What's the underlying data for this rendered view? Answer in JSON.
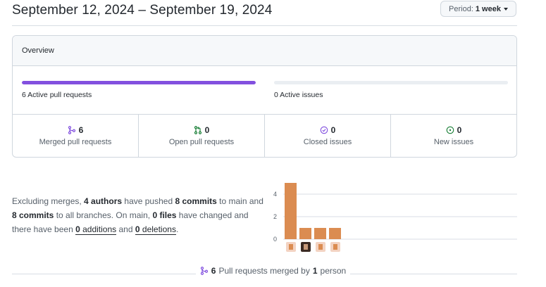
{
  "header": {
    "title": "September 12, 2024 – September 19, 2024",
    "period_prefix": "Period:",
    "period_value": "1 week"
  },
  "overview": {
    "title": "Overview",
    "prs_label": "6 Active pull requests",
    "prs_fill": 1.0,
    "issues_label": "0 Active issues",
    "issues_fill": 0.0,
    "colors": {
      "purple": "#8250df",
      "track": "#eaeef2",
      "green": "#1a7f37"
    },
    "stats": [
      {
        "icon": "git-merge-icon",
        "count": "6",
        "label": "Merged pull requests"
      },
      {
        "icon": "git-pull-request-icon",
        "count": "0",
        "label": "Open pull requests"
      },
      {
        "icon": "issue-closed-icon",
        "count": "0",
        "label": "Closed issues"
      },
      {
        "icon": "issue-opened-icon",
        "count": "0",
        "label": "New issues"
      }
    ]
  },
  "summary": {
    "p1": "Excluding merges, ",
    "authors": "4 authors",
    "p2": " have pushed ",
    "commits_main": "8 commits",
    "p3": " to main and ",
    "commits_all": "8 commits",
    "p4": " to all branches. On main, ",
    "files": "0 files",
    "p5": " have changed and there have been ",
    "additions_num": "0",
    "additions_word": "additions",
    "and": "and",
    "deletions_num": "0",
    "deletions_word": "deletions",
    "end": "."
  },
  "chart_data": {
    "type": "bar",
    "categories": [
      "author-1",
      "author-2",
      "author-3",
      "author-4"
    ],
    "values": [
      5,
      1,
      1,
      1
    ],
    "yticks": [
      0,
      2,
      4
    ],
    "ylim": [
      0,
      5
    ],
    "color": "#db8c51",
    "grid": true,
    "xlabel": "",
    "ylabel": ""
  },
  "footer": {
    "icon": "git-merge-icon",
    "count": "6",
    "text": "Pull requests merged by",
    "person_count": "1",
    "person_word": "person"
  }
}
